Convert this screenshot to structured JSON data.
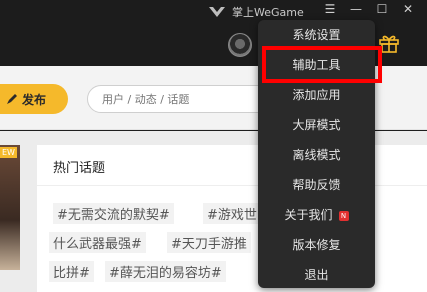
{
  "app": {
    "brand_name": "掌上WeGame"
  },
  "window_controls": {
    "menu": "☰",
    "minimize": "—",
    "maximize": "☐",
    "close": "✕"
  },
  "post": {
    "button_label": "发布"
  },
  "search": {
    "placeholder": "用户 / 动态 / 话题"
  },
  "promo": {
    "badge": "EW"
  },
  "topics": {
    "title": "热门话题",
    "tags": [
      "#无需交流的默契#",
      "#游戏世",
      "什么武器最强#",
      "#天刀手游推",
      "比拼#",
      "#薛无泪的易容坊#"
    ]
  },
  "menu": {
    "items": [
      "系统设置",
      "辅助工具",
      "添加应用",
      "大屏模式",
      "离线模式",
      "帮助反馈",
      "关于我们",
      "版本修复",
      "退出"
    ],
    "about_badge": "N",
    "highlighted_item": "辅助工具"
  },
  "colors": {
    "accent": "#f5b92b",
    "highlight": "#ff0000",
    "menu_bg": "#2a2a2a"
  }
}
